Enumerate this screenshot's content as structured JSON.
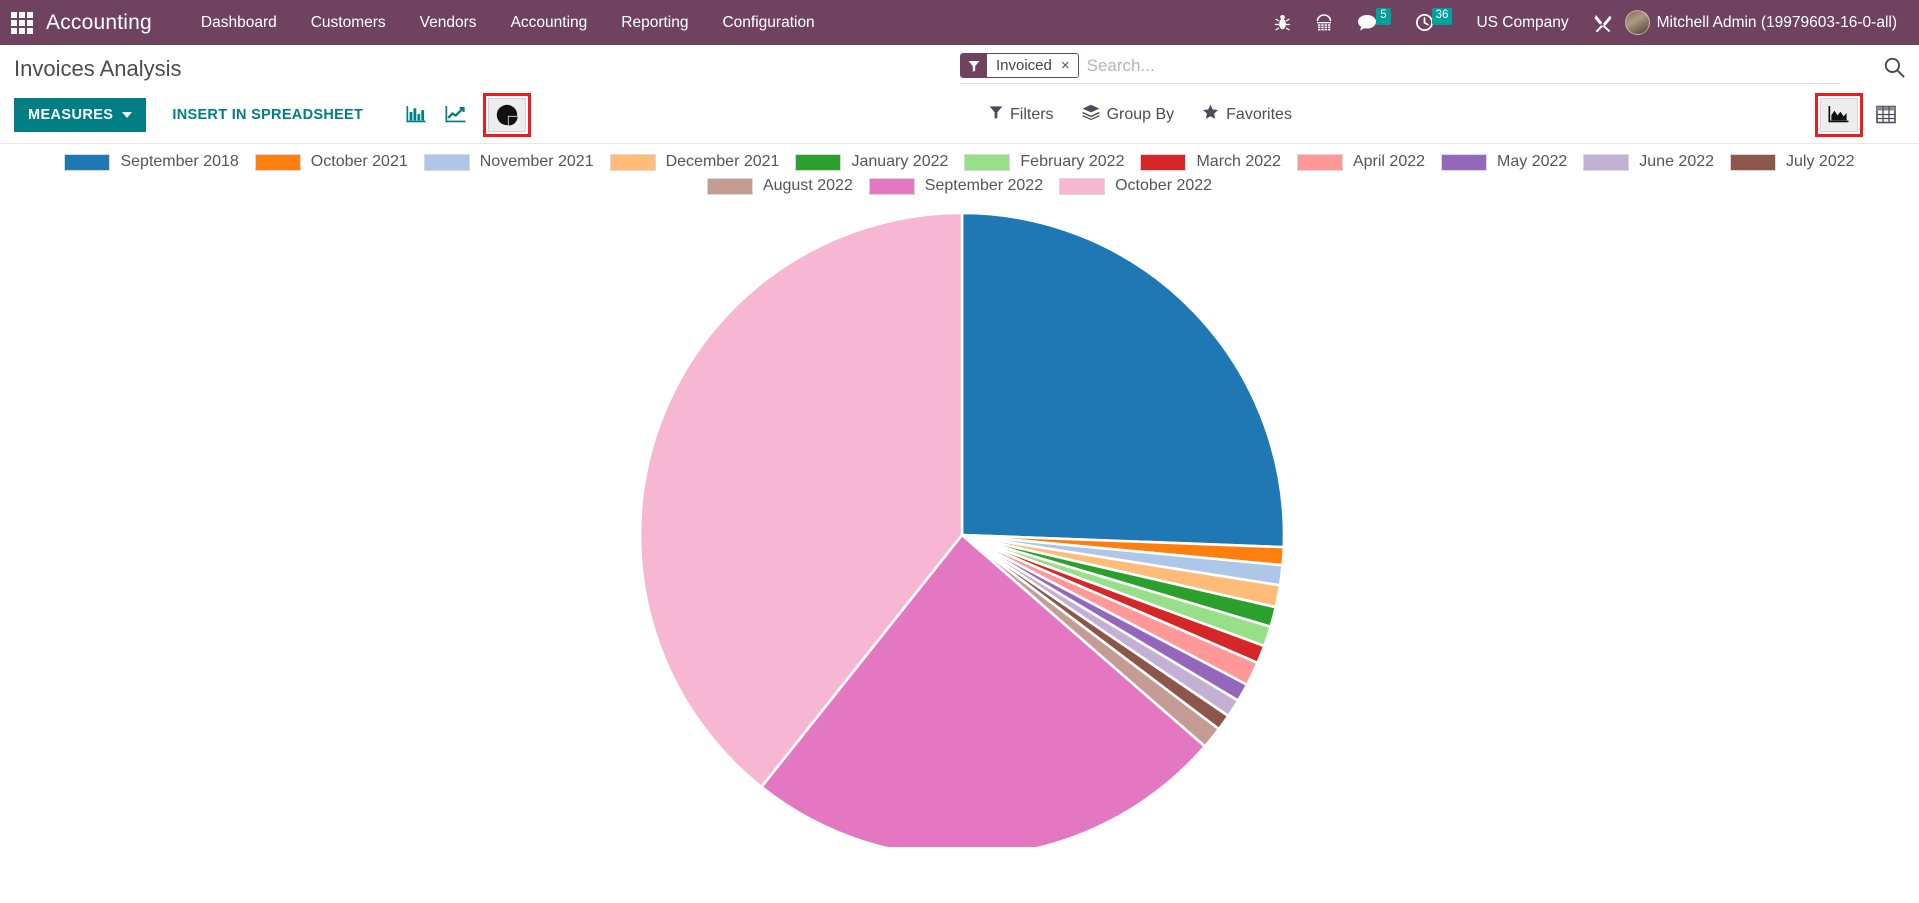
{
  "navbar": {
    "apps_icon": "apps-grid-icon",
    "brand": "Accounting",
    "menu": [
      {
        "label": "Dashboard"
      },
      {
        "label": "Customers"
      },
      {
        "label": "Vendors"
      },
      {
        "label": "Accounting"
      },
      {
        "label": "Reporting"
      },
      {
        "label": "Configuration"
      }
    ],
    "sys_icons": [
      {
        "name": "bug-icon",
        "glyph": "⚘"
      },
      {
        "name": "phone-icon",
        "glyph": "☎"
      }
    ],
    "messages_icon": "chat-bubble-icon",
    "messages_count": "5",
    "activities_icon": "clock-icon",
    "activities_count": "36",
    "company": "US Company",
    "tools_icon": "wrench-screwdriver-icon",
    "avatar": "user-avatar",
    "username": "Mitchell Admin (19979603-16-0-all)",
    "bg_color": "#6F4360",
    "badge_color": "#00A09D"
  },
  "control_panel": {
    "page_title": "Invoices Analysis",
    "measures_label": "MEASURES",
    "spreadsheet_label": "INSERT IN SPREADSHEET",
    "measures_color": "#017E84",
    "chart_types": [
      {
        "name": "bar-chart-icon",
        "label": "Bar Chart",
        "active": false
      },
      {
        "name": "line-chart-icon",
        "label": "Line Chart",
        "active": false
      },
      {
        "name": "pie-chart-icon",
        "label": "Pie Chart",
        "active": true
      }
    ],
    "filters_label": "Filters",
    "groupby_label": "Group By",
    "favorites_label": "Favorites",
    "view_switcher": [
      {
        "name": "graph-view-icon",
        "label": "Graph",
        "active": true
      },
      {
        "name": "pivot-view-icon",
        "label": "Pivot",
        "active": false
      }
    ],
    "highlight_color": "#ED1C24"
  },
  "search": {
    "facet_icon": "filter-funnel-icon",
    "facet_label": "Invoiced",
    "facet_remove": "×",
    "placeholder": "Search...",
    "value": "",
    "search_icon": "magnifier-icon"
  },
  "chart_data": {
    "type": "pie",
    "title": "Invoices Analysis",
    "legend_position": "top",
    "categories": [
      "September 2018",
      "October 2021",
      "November 2021",
      "December 2021",
      "January 2022",
      "February 2022",
      "March 2022",
      "April 2022",
      "May 2022",
      "June 2022",
      "July 2022",
      "August 2022",
      "September 2022",
      "October 2022"
    ],
    "colors": [
      "#1F77B4",
      "#FF7F0E",
      "#AEC7E8",
      "#FFBB78",
      "#2CA02C",
      "#98DF8A",
      "#D62728",
      "#FF9896",
      "#9467BD",
      "#C5B0D5",
      "#8C564B",
      "#C49C94",
      "#E377C2",
      "#F7B6D2"
    ],
    "values": [
      25.6,
      0.9,
      1.0,
      1.1,
      1.0,
      1.0,
      0.9,
      1.2,
      0.9,
      0.9,
      0.8,
      1.1,
      24.3,
      39.3
    ],
    "units": "percent",
    "slice_order": "clockwise-from-top"
  },
  "legend": [
    {
      "label": "September 2018",
      "color": "#1F77B4"
    },
    {
      "label": "October 2021",
      "color": "#FF7F0E"
    },
    {
      "label": "November 2021",
      "color": "#AEC7E8"
    },
    {
      "label": "December 2021",
      "color": "#FFBB78"
    },
    {
      "label": "January 2022",
      "color": "#2CA02C"
    },
    {
      "label": "February 2022",
      "color": "#98DF8A"
    },
    {
      "label": "March 2022",
      "color": "#D62728"
    },
    {
      "label": "April 2022",
      "color": "#FF9896"
    },
    {
      "label": "May 2022",
      "color": "#9467BD"
    },
    {
      "label": "June 2022",
      "color": "#C5B0D5"
    },
    {
      "label": "July 2022",
      "color": "#8C564B"
    },
    {
      "label": "August 2022",
      "color": "#C49C94"
    },
    {
      "label": "September 2022",
      "color": "#E377C2"
    },
    {
      "label": "October 2022",
      "color": "#F7B6D2"
    }
  ]
}
